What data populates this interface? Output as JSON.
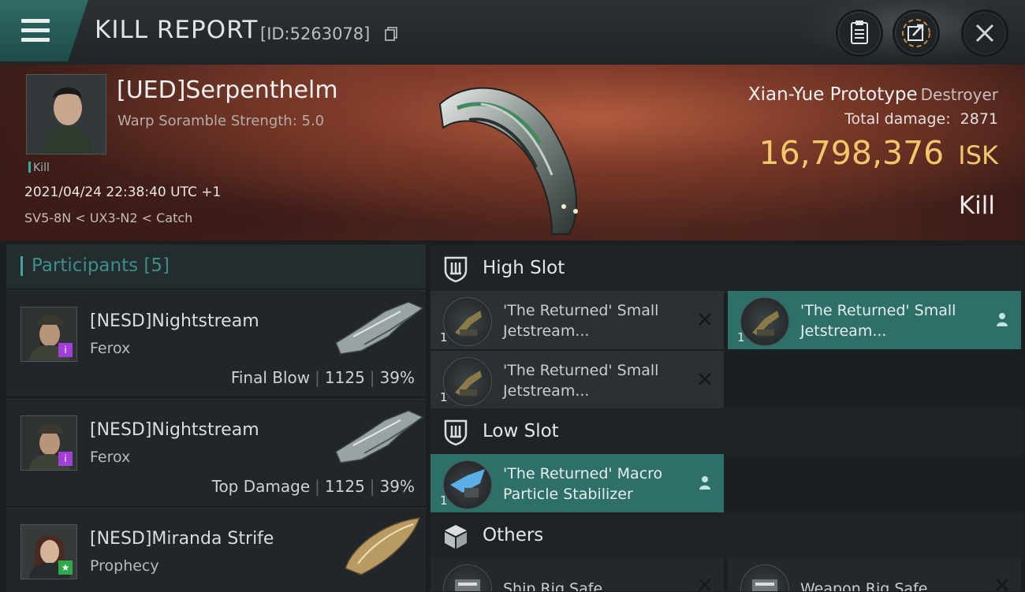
{
  "header": {
    "title": "KILL REPORT",
    "kill_id": "[ID:5263078]",
    "buttons": [
      "clipboard-icon",
      "share-icon",
      "close-icon"
    ]
  },
  "victim": {
    "name": "[UED]Serpenthelm",
    "subtitle": "Warp Soramble Strength: 5.0",
    "tag": "Kill",
    "time": "2021/04/24 22:38:40 UTC +1",
    "location": "SV5-8N < UX3-N2 < Catch",
    "ship_name": "Xian-Yue Prototype",
    "ship_class": "Destroyer",
    "damage_label": "Total damage:",
    "damage_value": "2871",
    "isk_value": "16,798,376",
    "isk_unit": "ISK",
    "result": "Kill"
  },
  "participants": {
    "title": "Participants [5]",
    "items": [
      {
        "name": "[NESD]Nightstream",
        "ship": "Ferox",
        "role": "Final Blow",
        "damage": "1125",
        "percent": "39%",
        "badge": "i",
        "badge_color": "#a23fd6"
      },
      {
        "name": "[NESD]Nightstream",
        "ship": "Ferox",
        "role": "Top Damage",
        "damage": "1125",
        "percent": "39%",
        "badge": "i",
        "badge_color": "#a23fd6"
      },
      {
        "name": "[NESD]Miranda Strife",
        "ship": "Prophecy",
        "role": "",
        "damage": "",
        "percent": "",
        "badge": "★",
        "badge_color": "#2fa84a"
      }
    ]
  },
  "slots": {
    "high": {
      "title": "High Slot",
      "modules": [
        {
          "name": "'The Returned' Small Jetstream...",
          "qty": "1",
          "status": "destroyed"
        },
        {
          "name": "'The Returned' Small Jetstream...",
          "qty": "1",
          "status": "dropped"
        },
        {
          "name": "'The Returned' Small Jetstream...",
          "qty": "1",
          "status": "destroyed"
        }
      ]
    },
    "low": {
      "title": "Low Slot",
      "modules": [
        {
          "name": "'The Returned' Macro Particle Stabilizer",
          "qty": "1",
          "status": "dropped"
        }
      ]
    },
    "others": {
      "title": "Others",
      "modules": [
        {
          "name": "Ship Rig Safe",
          "status": "destroyed"
        },
        {
          "name": "Weapon Rig Safe",
          "status": "destroyed"
        }
      ]
    }
  },
  "colors": {
    "accent": "#3fa79b",
    "isk": "#f3c86b",
    "dropped_bg": "#2f6f69"
  }
}
